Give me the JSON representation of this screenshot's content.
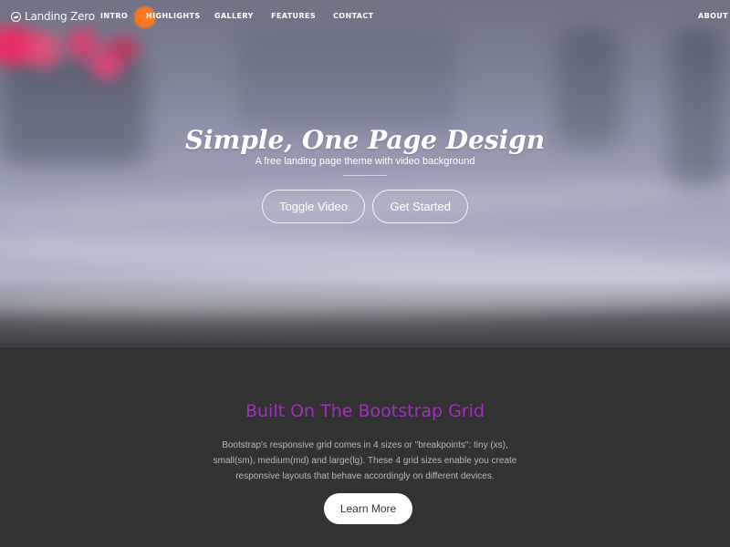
{
  "nav": {
    "brand_label": "Landing Zero",
    "brand_icon": "landing-zero-logo-icon",
    "links": [
      {
        "label": "Intro"
      },
      {
        "label": "Highlights"
      },
      {
        "label": "Gallery"
      },
      {
        "label": "Features"
      },
      {
        "label": "Contact"
      }
    ],
    "right_link": "About"
  },
  "hero": {
    "title": "Simple, One Page Design",
    "subtitle": "A free landing page theme with video background",
    "buttons": [
      {
        "label": "Toggle Video"
      },
      {
        "label": "Get Started"
      }
    ]
  },
  "section": {
    "heading": "Built On The Bootstrap Grid",
    "body": "Bootstrap's responsive grid comes in 4 sizes or \"breakpoints\": tiny (xs), small(sm), medium(md) and large(lg). These 4 grid sizes enable you create responsive layouts that behave accordingly on different devices.",
    "button_label": "Learn More"
  },
  "colors": {
    "hero_text": "#ffffff",
    "section_background": "#333333",
    "heading_accent": "#a12fbf",
    "section_text": "#b6b6b6",
    "button_background": "#ffffff",
    "button_text": "#333333"
  }
}
